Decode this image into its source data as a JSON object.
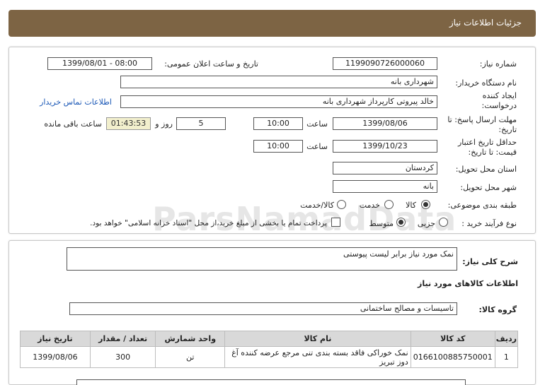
{
  "header": {
    "title": "جزئیات اطلاعات نیاز"
  },
  "details": {
    "need_number_label": "شماره نیاز:",
    "need_number": "1199090726000060",
    "announce_label": "تاریخ و ساعت اعلان عمومی:",
    "announce_value": "1399/08/01 - 08:00",
    "buyer_label": "نام دستگاه خریدار:",
    "buyer_value": "شهرداری بانه",
    "creator_label": "ایجاد کننده درخواست:",
    "creator_value": "خالد پیروتی کارپرداز شهرداری بانه",
    "contact_link": "اطلاعات تماس خریدار",
    "deadline_label": "مهلت ارسال پاسخ: تا تاریخ:",
    "deadline_date": "1399/08/06",
    "time_label": "ساعت",
    "deadline_time": "10:00",
    "days_value": "5",
    "days_label": "روز و",
    "remaining_time": "01:43:53",
    "remaining_label": "ساعت باقی مانده",
    "validity_label": "حداقل تاریخ اعتبار قیمت: تا تاریخ:",
    "validity_date": "1399/10/23",
    "validity_time": "10:00",
    "province_label": "استان محل تحویل:",
    "province_value": "کردستان",
    "city_label": "شهر محل تحویل:",
    "city_value": "بانه",
    "category_label": "طبقه بندی موضوعی:",
    "category_options": [
      "کالا",
      "خدمت",
      "کالا/خدمت"
    ],
    "category_selected": "کالا",
    "process_label": "نوع فرآیند خرید :",
    "process_options": [
      "جزیی",
      "متوسط"
    ],
    "process_selected": "متوسط",
    "payment_note": "پرداخت تمام یا بخشی از مبلغ خرید،از محل \"اسناد خزانه اسلامی\" خواهد بود."
  },
  "summary": {
    "title_label": "شرح کلی نیاز:",
    "title_value": "نمک مورد نیاز برابر لیست پیوستی",
    "goods_heading": "اطلاعات کالاهای مورد نیاز",
    "group_label": "گروه کالا:",
    "group_value": "تاسیسات و مصالح ساختمانی"
  },
  "table": {
    "headers": [
      "ردیف",
      "کد کالا",
      "نام کالا",
      "واحد شمارش",
      "تعداد / مقدار",
      "تاریخ نیاز"
    ],
    "rows": [
      {
        "row": "1",
        "code": "0166100885750001",
        "name": "نمک خوراکی فاقد بسته بندی تنی مرجع عرضه کننده آغ دوز تبریز",
        "unit": "تن",
        "qty": "300",
        "date": "1399/08/06"
      }
    ]
  },
  "watermark": {
    "line1": "ParsNamadData",
    "line2": "پایگاه اطلاع رسانی مناقصه و مزایده",
    "line3": "۰۲۱-۸۸۳۴۹۶۷۰-۵"
  },
  "colors": {
    "header_bg": "#7d6444",
    "link": "#1a57b6",
    "timer_bg": "#f2efcd",
    "table_head": "#d9d9d9"
  }
}
